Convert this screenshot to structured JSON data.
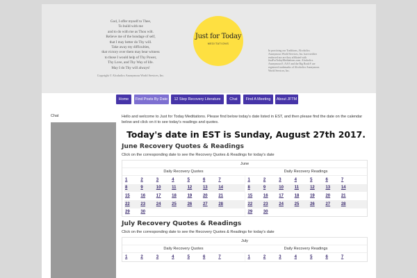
{
  "header": {
    "prayer": [
      "God, I offer myself to Thee,",
      "To build with me",
      "and to do with me as Thou wilt.",
      "Relieve me of the bondage of self,",
      "that I may better do Thy will.",
      "Take away my difficulties,",
      "that victory over them may bear witness",
      "to those I would help of Thy Power,",
      "Thy Love, and Thy Way of life.",
      "May I do Thy will always!"
    ],
    "copyright": "Copyright © Alcoholics Anonymous World Services, Inc.",
    "logo_title": "Just for Today",
    "logo_subtitle": "MEDITATIONS",
    "notice": "In practicing our Traditions, Alcoholics Anonymous World Services, Inc. have neither endorsed nor are they affiliated with JustForTodayMeditations.com. Alcoholics Anonymous®, AA® and the Big Book® are registered trademarks of Alcoholics Anonymous World Services, Inc."
  },
  "nav": [
    "Home",
    "Find Posts By Date",
    "12 Step Recovery Literature",
    "Chat",
    "Find A Meeting",
    "About JFTM"
  ],
  "sidebar": {
    "chat_label": "Chat"
  },
  "main": {
    "intro": "Hello and welcome to Just for Today Meditations. Please find below today's date listed in EST, and then please find the date on the calendar below and click on it to see today's readings and quotes.",
    "date_heading": "Today's date in EST is Sunday, August 27th 2017.",
    "sections": [
      {
        "heading": "June Recovery Quotes & Readings",
        "note": "Click on the corresponding date to see the Recovery Quotes & Readings for today's date",
        "month": "June",
        "col_quotes": "Daily Recovery Quotes",
        "col_readings": "Daily Recovery Readings",
        "rows": [
          [
            "1",
            "2",
            "3",
            "4",
            "5",
            "6",
            "7"
          ],
          [
            "8",
            "9",
            "10",
            "11",
            "12",
            "13",
            "14"
          ],
          [
            "15",
            "16",
            "17",
            "18",
            "19",
            "20",
            "21"
          ],
          [
            "22",
            "23",
            "24",
            "25",
            "26",
            "27",
            "28"
          ],
          [
            "29",
            "30"
          ]
        ]
      },
      {
        "heading": "July Recovery Quotes & Readings",
        "note": "Click on the corresponding date to see the Recovery Quotes & Readings for today's date",
        "month": "July",
        "col_quotes": "Daily Recovery Quotes",
        "col_readings": "Daily Recovery Readings",
        "rows": [
          [
            "1",
            "2",
            "3",
            "4",
            "5",
            "6",
            "7"
          ]
        ]
      }
    ]
  },
  "colors": {
    "nav": "#4634a8",
    "nav_active": "#7d6fd1",
    "logo": "#fee041",
    "header_bg": "#e9e9e9",
    "sidebar": "#9a9a9a"
  }
}
